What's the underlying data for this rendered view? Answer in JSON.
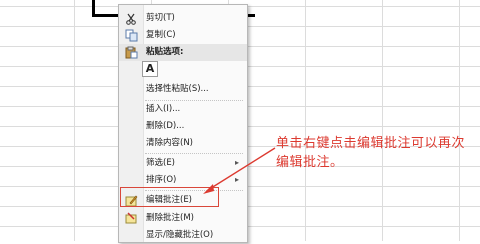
{
  "menu": {
    "cut": "剪切(T)",
    "copy": "复制(C)",
    "paste_options": "粘贴选项:",
    "paste_a": "A",
    "paste_special": "选择性粘贴(S)...",
    "insert": "插入(I)...",
    "delete": "删除(D)...",
    "clear_contents": "清除内容(N)",
    "filter": "筛选(E)",
    "sort": "排序(O)",
    "edit_comment": "编辑批注(E)",
    "delete_comment": "删除批注(M)",
    "show_hide_comments": "显示/隐藏批注(O)"
  },
  "annotation": "单击右键点击编辑批注可以再次编辑批注。",
  "colors": {
    "annotation": "#dc3a30",
    "grid": "#dcdcdc"
  }
}
